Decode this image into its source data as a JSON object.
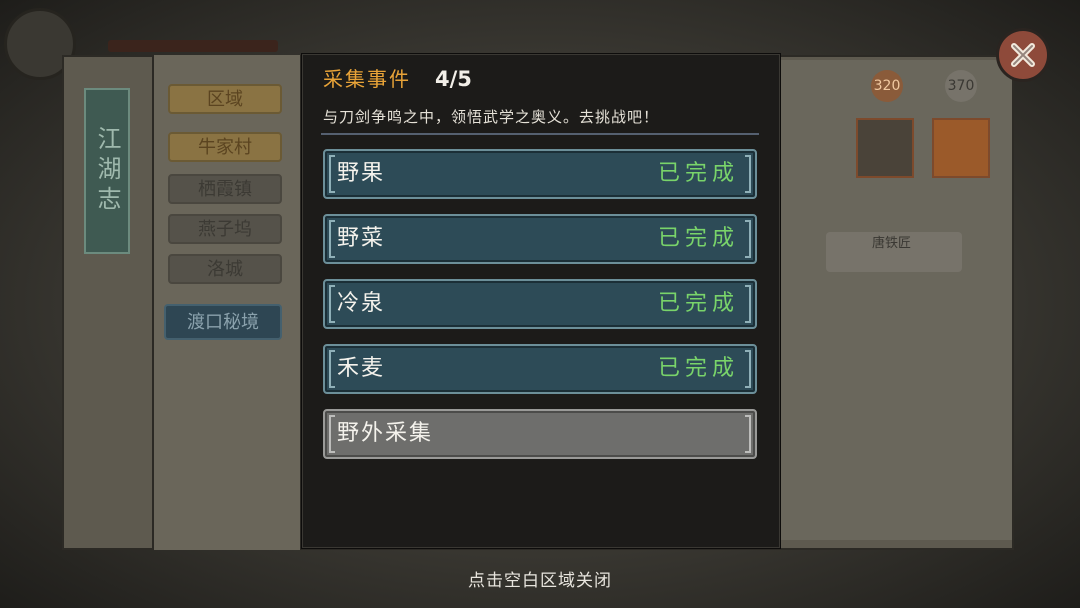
{
  "background": {
    "side_banner": "江湖志",
    "region_tab": "区域",
    "locations": [
      "牛家村",
      "栖霞镇",
      "燕子坞",
      "洛城"
    ],
    "secret_realm": "渡口秘境",
    "reward_marks": [
      "320",
      "370"
    ],
    "npc_name": "唐铁匠"
  },
  "dialog": {
    "title": "采集事件",
    "progress": "4/5",
    "description": "与刀剑争鸣之中，领悟武学之奥义。去挑战吧！",
    "events": [
      {
        "name": "野果",
        "status": "已完成",
        "completed": true
      },
      {
        "name": "野菜",
        "status": "已完成",
        "completed": true
      },
      {
        "name": "冷泉",
        "status": "已完成",
        "completed": true
      },
      {
        "name": "禾麦",
        "status": "已完成",
        "completed": true
      },
      {
        "name": "野外采集",
        "status": "",
        "completed": false
      }
    ]
  },
  "hint": "点击空白区域关闭",
  "colors": {
    "title": "#e8a338",
    "completed": "#79d46a",
    "event_bg": "#2d4b57",
    "event_pending_bg": "#6e6e6c"
  },
  "icons": {
    "close": "close-icon"
  }
}
